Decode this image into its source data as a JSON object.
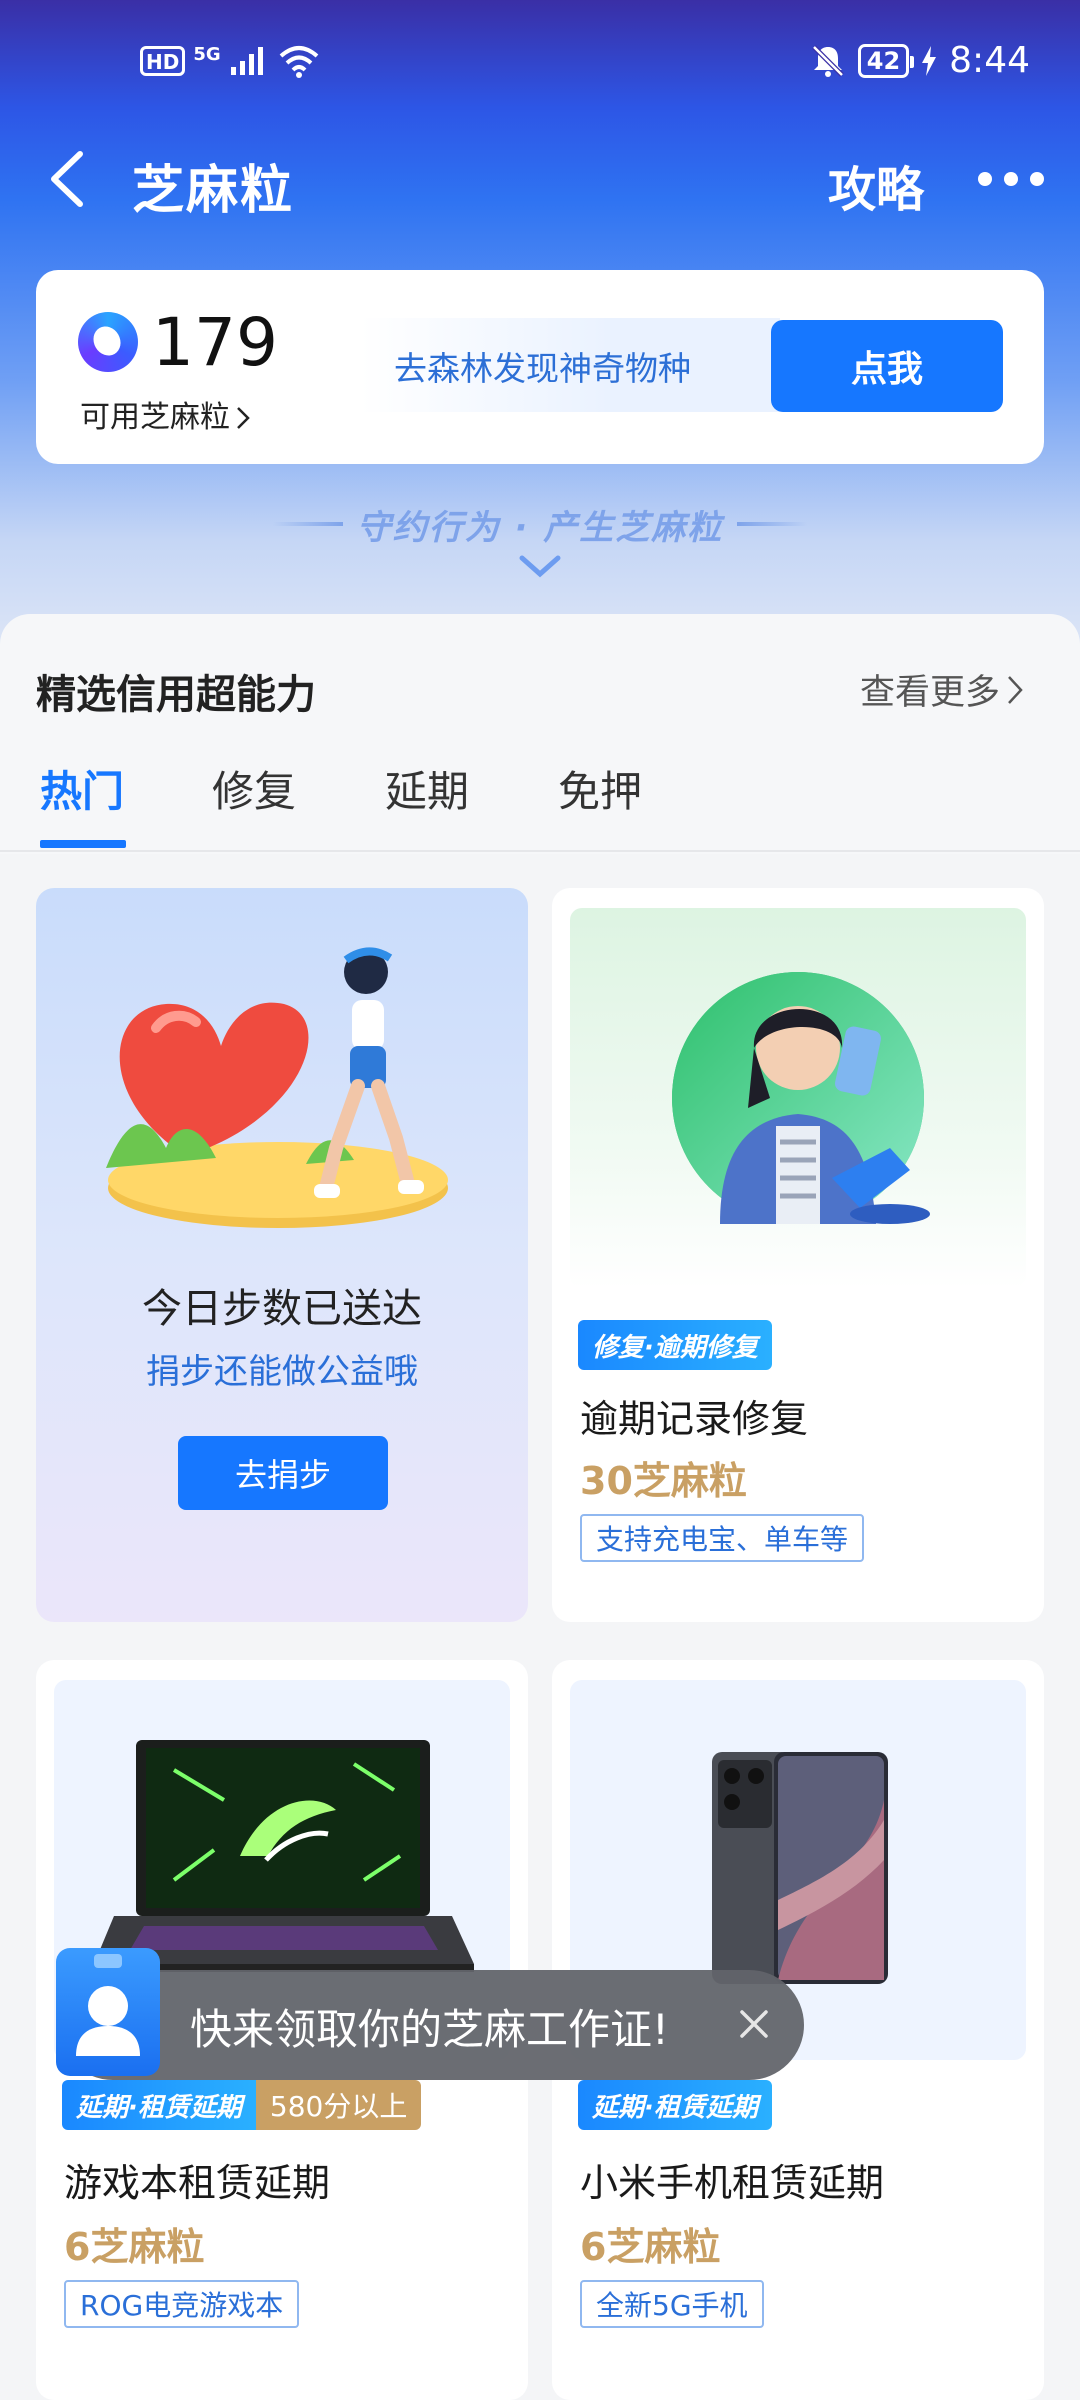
{
  "status_bar": {
    "hd": "HD",
    "network": "5G",
    "battery": "42",
    "time": "8:44"
  },
  "nav": {
    "title": "芝麻粒",
    "guide": "攻略"
  },
  "points": {
    "value": "179",
    "label": "可用芝麻粒",
    "promo_text": "去森林发现神奇物种",
    "promo_button": "点我"
  },
  "slogan": "守约行为 · 产生芝麻粒",
  "section": {
    "title": "精选信用超能力",
    "view_more": "查看更多",
    "tabs": [
      "热门",
      "修复",
      "延期",
      "免押"
    ],
    "active_tab": 0
  },
  "cards": {
    "steps": {
      "title": "今日步数已送达",
      "subtitle": "捐步还能做公益哦",
      "button": "去捐步"
    },
    "repair": {
      "tag": "修复·逾期修复",
      "name": "逾期记录修复",
      "price": "30芝麻粒",
      "note": "支持充电宝、单车等"
    },
    "laptop": {
      "tag": "延期·租赁延期",
      "tag_extra": "580分以上",
      "name": "游戏本租赁延期",
      "price": "6芝麻粒",
      "note": "ROG电竞游戏本"
    },
    "phone": {
      "tag": "延期·租赁延期",
      "name": "小米手机租赁延期",
      "price": "6芝麻粒",
      "note": "全新5G手机"
    }
  },
  "toast": {
    "text": "快来领取你的芝麻工作证!"
  },
  "colors": {
    "primary": "#1677ff",
    "gold": "#c9a064",
    "header_top": "#3a2fa6"
  }
}
